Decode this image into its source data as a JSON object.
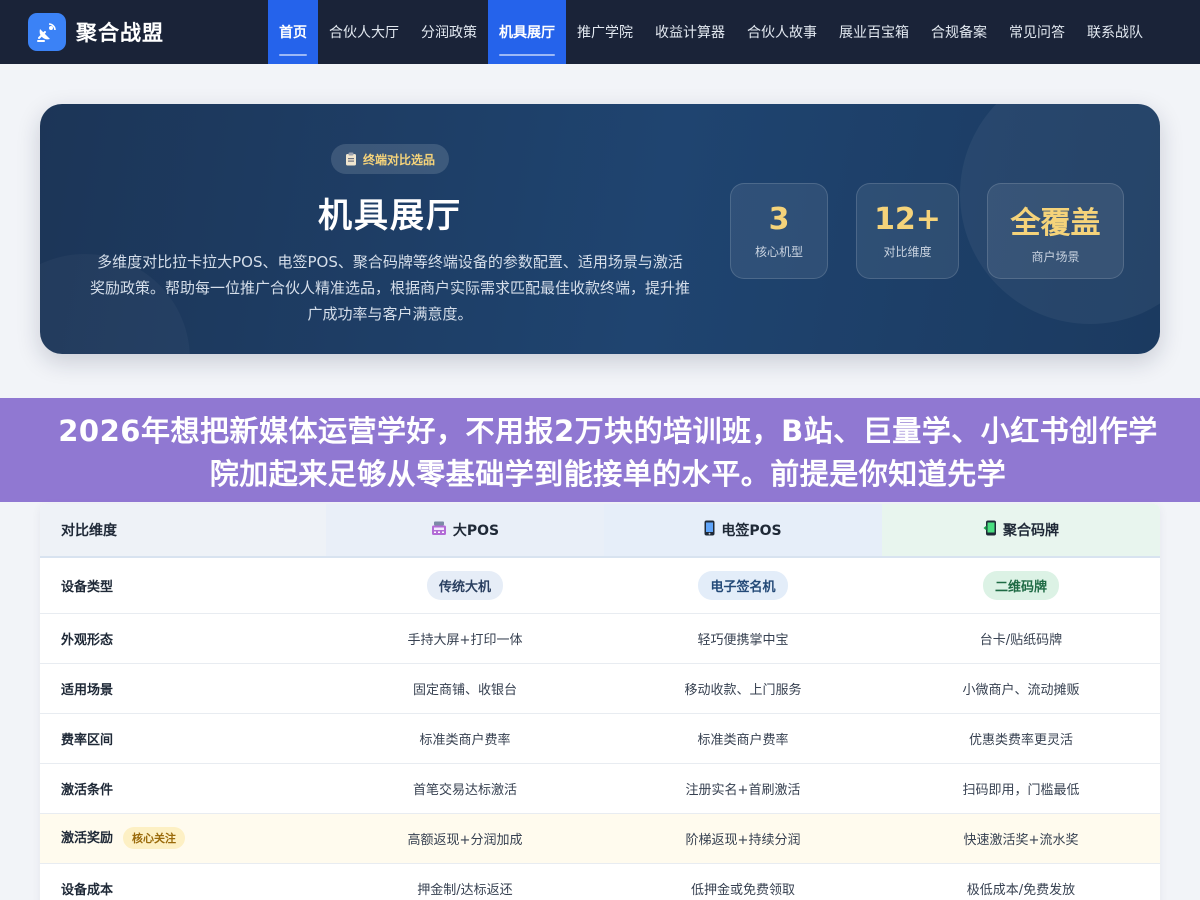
{
  "brand": {
    "name": "聚合战盟",
    "logo_icon": "satellite-dish-icon"
  },
  "nav": {
    "items": [
      {
        "label": "首页",
        "active": true
      },
      {
        "label": "合伙人大厅",
        "active": false
      },
      {
        "label": "分润政策",
        "active": false
      },
      {
        "label": "机具展厅",
        "active": true
      },
      {
        "label": "推广学院",
        "active": false
      },
      {
        "label": "收益计算器",
        "active": false
      },
      {
        "label": "合伙人故事",
        "active": false
      },
      {
        "label": "展业百宝箱",
        "active": false
      },
      {
        "label": "合规备案",
        "active": false
      },
      {
        "label": "常见问答",
        "active": false
      },
      {
        "label": "联系战队",
        "active": false
      }
    ]
  },
  "hero": {
    "tag": "终端对比选品",
    "tag_icon": "clipboard-icon",
    "title": "机具展厅",
    "description": "多维度对比拉卡拉大POS、电签POS、聚合码牌等终端设备的参数配置、适用场景与激活奖励政策。帮助每一位推广合伙人精准选品，根据商户实际需求匹配最佳收款终端，提升推广成功率与客户满意度。",
    "stats": [
      {
        "value": "3",
        "label": "核心机型"
      },
      {
        "value": "12+",
        "label": "对比维度"
      },
      {
        "value": "全覆盖",
        "label": "商户场景"
      }
    ]
  },
  "banner": {
    "text": "2026年想把新媒体运营学好，不用报2万块的培训班，B站、巨量学、小红书创作学院加起来足够从零基础学到能接单的水平。前提是你知道先学"
  },
  "table": {
    "headers": {
      "dimension": "对比维度",
      "col1": "大POS",
      "col2": "电签POS",
      "col3": "聚合码牌"
    },
    "header_icons": [
      "cash-register-icon",
      "mobile-phone-icon",
      "qr-plaque-icon"
    ],
    "rows": [
      {
        "label": "设备类型",
        "c1": "传统大机",
        "c2": "电子签名机",
        "c3": "二维码牌"
      },
      {
        "label": "外观形态",
        "c1": "手持大屏+打印一体",
        "c2": "轻巧便携掌中宝",
        "c3": "台卡/贴纸码牌"
      },
      {
        "label": "适用场景",
        "c1": "固定商铺、收银台",
        "c2": "移动收款、上门服务",
        "c3": "小微商户、流动摊贩"
      },
      {
        "label": "费率区间",
        "c1": "标准类商户费率",
        "c2": "标准类商户费率",
        "c3": "优惠类费率更灵活"
      },
      {
        "label": "激活条件",
        "c1": "首笔交易达标激活",
        "c2": "注册实名+首刷激活",
        "c3": "扫码即用，门槛最低"
      },
      {
        "label": "激活奖励",
        "badge": "核心关注",
        "c1": "高额返现+分润加成",
        "c2": "阶梯返现+持续分润",
        "c3": "快速激活奖+流水奖"
      },
      {
        "label": "设备成本",
        "c1": "押金制/达标返还",
        "c2": "低押金或免费领取",
        "c3": "极低成本/免费发放"
      }
    ]
  }
}
